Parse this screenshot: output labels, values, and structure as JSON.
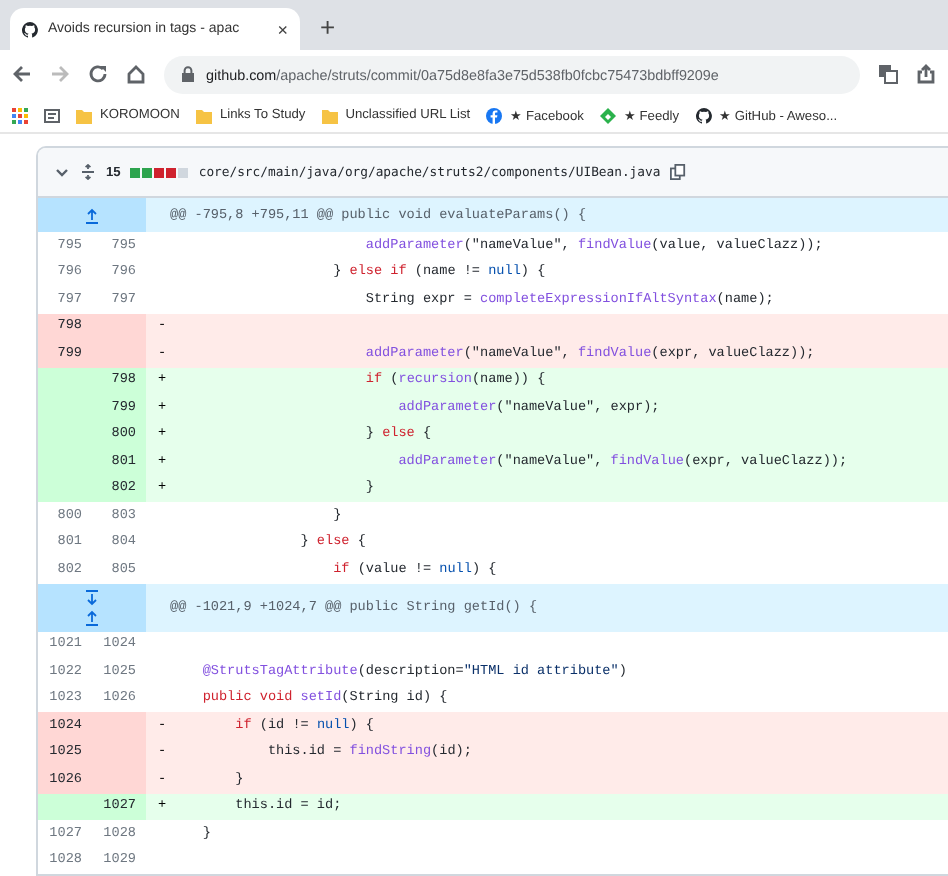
{
  "browser": {
    "tab": {
      "title": "Avoids recursion in tags - apac",
      "close": "×"
    },
    "new_tab": "+",
    "url": {
      "domain": "github.com",
      "path": "/apache/struts/commit/0a75d8e8fa3e75d538fb0fcbc75473bdbff9209e"
    },
    "bookmarks": [
      {
        "kind": "folder",
        "label": "KOROMOON"
      },
      {
        "kind": "folder",
        "label": "Links To Study"
      },
      {
        "kind": "folder",
        "label": "Unclassified URL List"
      },
      {
        "kind": "facebook",
        "label": "★ Facebook"
      },
      {
        "kind": "feedly",
        "label": "★ Feedly"
      },
      {
        "kind": "github",
        "label": "★ GitHub - Aweso..."
      }
    ]
  },
  "file": {
    "expanded": true,
    "changes": "15",
    "diffstat": [
      {
        "color": "#2da44e"
      },
      {
        "color": "#2da44e"
      },
      {
        "color": "#cf222e"
      },
      {
        "color": "#cf222e"
      },
      {
        "color": "#d0d7de"
      }
    ],
    "path": "core/src/main/java/org/apache/struts2/components/UIBean.java"
  },
  "hunks": [
    {
      "expand_up": true,
      "header": "@@ -795,8 +795,11 @@ public void evaluateParams() {",
      "lines": [
        {
          "kind": "context",
          "old": "795",
          "new": "795",
          "code": [
            {
              "kind": "fn",
              "text": "                        addParameter"
            },
            {
              "kind": "plain",
              "text": "(\"nameValue\", "
            },
            {
              "kind": "fn",
              "text": "findValue"
            },
            {
              "kind": "plain",
              "text": "(value, valueClazz));"
            }
          ]
        },
        {
          "kind": "context",
          "old": "796",
          "new": "796",
          "code": [
            {
              "kind": "plain",
              "text": "                    } "
            },
            {
              "kind": "kw",
              "text": "else if"
            },
            {
              "kind": "plain",
              "text": " (name != "
            },
            {
              "kind": "const",
              "text": "null"
            },
            {
              "kind": "plain",
              "text": ") {"
            }
          ]
        },
        {
          "kind": "context",
          "old": "797",
          "new": "797",
          "code": [
            {
              "kind": "plain",
              "text": "                        String expr = "
            },
            {
              "kind": "fn",
              "text": "completeExpressionIfAltSyntax"
            },
            {
              "kind": "plain",
              "text": "(name);"
            }
          ]
        },
        {
          "kind": "del",
          "old": "798",
          "sign": "-"
        },
        {
          "kind": "del",
          "old": "799",
          "sign": "-",
          "code": [
            {
              "kind": "fn",
              "text": "                        addParameter"
            },
            {
              "kind": "plain",
              "text": "(\"nameValue\", "
            },
            {
              "kind": "fn",
              "text": "findValue"
            },
            {
              "kind": "plain",
              "text": "(expr, valueClazz));"
            }
          ]
        },
        {
          "kind": "add",
          "new": "798",
          "sign": "+",
          "code": [
            {
              "kind": "kw",
              "text": "                        if"
            },
            {
              "kind": "plain",
              "text": " ("
            },
            {
              "kind": "fn",
              "text": "recursion"
            },
            {
              "kind": "plain",
              "text": "(name)) {"
            }
          ]
        },
        {
          "kind": "add",
          "new": "799",
          "sign": "+",
          "code": [
            {
              "kind": "fn",
              "text": "                            addParameter"
            },
            {
              "kind": "plain",
              "text": "(\"nameValue\", expr);"
            }
          ]
        },
        {
          "kind": "add",
          "new": "800",
          "sign": "+",
          "code": [
            {
              "kind": "plain",
              "text": "                        } "
            },
            {
              "kind": "kw",
              "text": "else"
            },
            {
              "kind": "plain",
              "text": " {"
            }
          ]
        },
        {
          "kind": "add",
          "new": "801",
          "sign": "+",
          "code": [
            {
              "kind": "fn",
              "text": "                            addParameter"
            },
            {
              "kind": "plain",
              "text": "(\"nameValue\", "
            },
            {
              "kind": "fn",
              "text": "findValue"
            },
            {
              "kind": "plain",
              "text": "(expr, valueClazz));"
            }
          ]
        },
        {
          "kind": "add",
          "new": "802",
          "sign": "+",
          "code": [
            {
              "kind": "plain",
              "text": "                        }"
            }
          ]
        },
        {
          "kind": "context",
          "old": "800",
          "new": "803",
          "code": [
            {
              "kind": "plain",
              "text": "                    }"
            }
          ]
        },
        {
          "kind": "context",
          "old": "801",
          "new": "804",
          "code": [
            {
              "kind": "plain",
              "text": "                } "
            },
            {
              "kind": "kw",
              "text": "else"
            },
            {
              "kind": "plain",
              "text": " {"
            }
          ]
        },
        {
          "kind": "context",
          "old": "802",
          "new": "805",
          "code": [
            {
              "kind": "kw",
              "text": "                    if"
            },
            {
              "kind": "plain",
              "text": " (value != "
            },
            {
              "kind": "const",
              "text": "null"
            },
            {
              "kind": "plain",
              "text": ") {"
            }
          ]
        }
      ]
    },
    {
      "expand_down": true,
      "expand_up": true,
      "header": "@@ -1021,9 +1024,7 @@ public String getId() {",
      "lines": [
        {
          "kind": "context",
          "old": "1021",
          "new": "1024"
        },
        {
          "kind": "context",
          "old": "1022",
          "new": "1025",
          "code": [
            {
              "kind": "fn",
              "text": "    @StrutsTagAttribute"
            },
            {
              "kind": "plain",
              "text": "(description="
            },
            {
              "kind": "str",
              "text": "\"HTML id attribute\""
            },
            {
              "kind": "plain",
              "text": ")"
            }
          ]
        },
        {
          "kind": "context",
          "old": "1023",
          "new": "1026",
          "code": [
            {
              "kind": "kw",
              "text": "    public void "
            },
            {
              "kind": "fn",
              "text": "setId"
            },
            {
              "kind": "plain",
              "text": "(String id) {"
            }
          ]
        },
        {
          "kind": "del",
          "old": "1024",
          "sign": "-",
          "code": [
            {
              "kind": "kw",
              "text": "        if"
            },
            {
              "kind": "plain",
              "text": " (id != "
            },
            {
              "kind": "const",
              "text": "null"
            },
            {
              "kind": "plain",
              "text": ") {"
            }
          ]
        },
        {
          "kind": "del",
          "old": "1025",
          "sign": "-",
          "code": [
            {
              "kind": "plain",
              "text": "            this.id = "
            },
            {
              "kind": "fn",
              "text": "findString"
            },
            {
              "kind": "plain",
              "text": "(id);"
            }
          ]
        },
        {
          "kind": "del",
          "old": "1026",
          "sign": "-",
          "code": [
            {
              "kind": "plain",
              "text": "        }"
            }
          ]
        },
        {
          "kind": "add",
          "new": "1027",
          "sign": "+",
          "code": [
            {
              "kind": "plain",
              "text": "        this.id = id;"
            }
          ]
        },
        {
          "kind": "context",
          "old": "1027",
          "new": "1028",
          "code": [
            {
              "kind": "plain",
              "text": "    }"
            }
          ]
        },
        {
          "kind": "context",
          "old": "1028",
          "new": "1029"
        }
      ]
    }
  ]
}
